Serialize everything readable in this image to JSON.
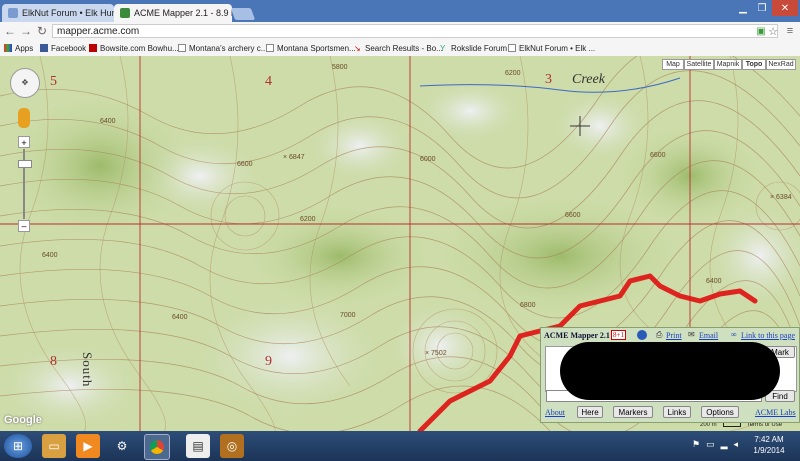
{
  "browser": {
    "tabs": [
      {
        "label": "ElkNut Forum • Elk Huntin",
        "active": false
      },
      {
        "label": "ACME Mapper 2.1 - 8.9 km",
        "active": true
      }
    ],
    "url": "mapper.acme.com",
    "bookmarks": [
      "Apps",
      "Facebook",
      "Bowsite.com Bowhu...",
      "Montana's archery c...",
      "Montana Sportsmen...",
      "Search Results - Bo...",
      "Rokslide Forum",
      "ElkNut Forum • Elk ..."
    ]
  },
  "map": {
    "types": [
      "Map",
      "Satellite",
      "Mapnik",
      "Topo",
      "NexRad"
    ],
    "selected_type": "Topo",
    "sections": [
      "5",
      "4",
      "3",
      "8",
      "9"
    ],
    "creek_label": "Creek",
    "south_label": "South",
    "contour_labels": [
      "5800",
      "6400",
      "6200",
      "6600",
      "6600",
      "6000",
      "× 6847",
      "6400",
      "6800",
      "6400",
      "7000",
      "× 7502",
      "6400",
      "6600",
      "6200",
      "× 6384"
    ],
    "attribution": "Google",
    "scale": "200 m",
    "terms": "Terms of Use",
    "colors": {
      "track": "#e01010",
      "section": "#b03030"
    }
  },
  "panel": {
    "title": "ACME Mapper 2.1",
    "plus_badge": "8+1",
    "print": "Print",
    "email": "Email",
    "link": "Link to this page",
    "mark": "Mark",
    "find": "Find",
    "buttons": [
      "About",
      "Here",
      "Markers",
      "Links",
      "Options",
      "ACME Labs"
    ]
  },
  "taskbar": {
    "time": "7:42 AM",
    "date": "1/9/2014"
  }
}
